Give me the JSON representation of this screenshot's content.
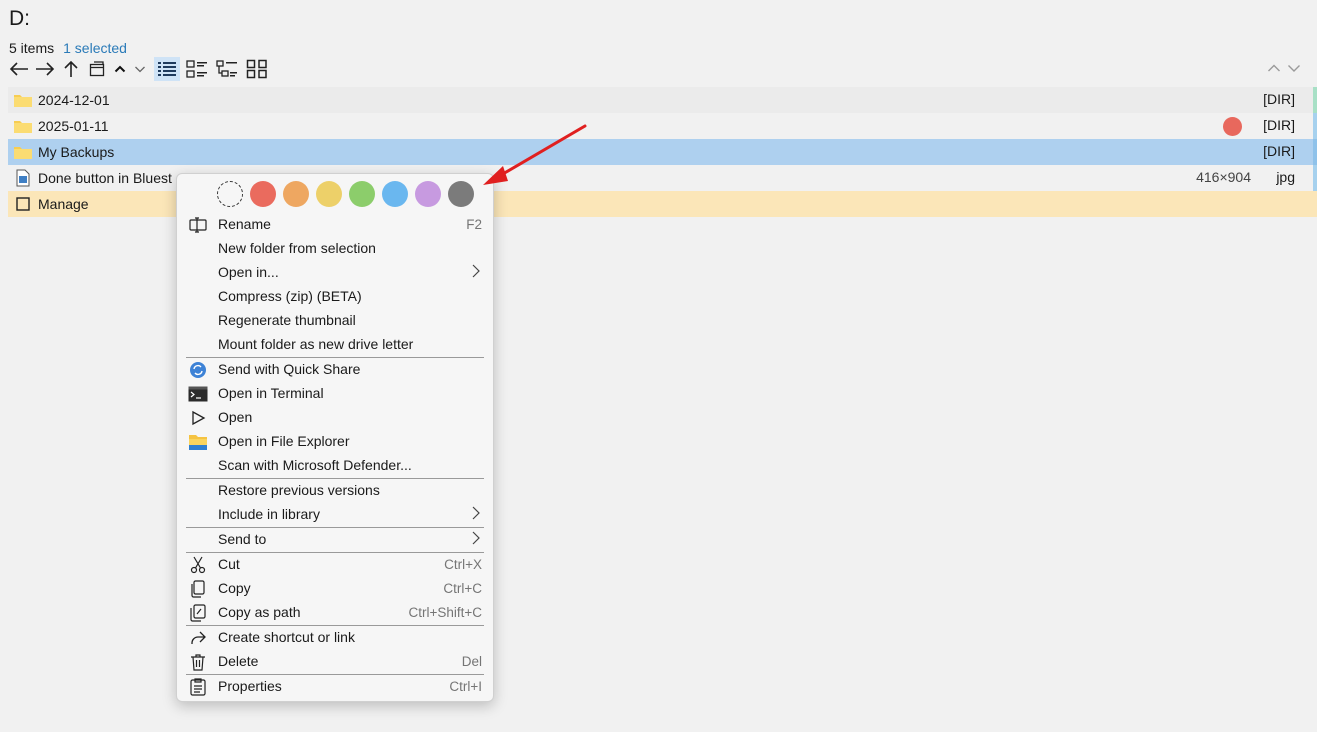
{
  "location": {
    "title": "D:"
  },
  "status": {
    "item_count": "5 items",
    "selection": "1 selected"
  },
  "toolbar": {
    "icons": [
      "back-arrow-icon",
      "forward-arrow-icon",
      "up-arrow-icon",
      "new-tab-icon",
      "chevron-up-icon",
      "chevron-down-icon",
      "details-view-icon",
      "list-view-icon",
      "tree-view-icon",
      "grid-view-icon"
    ],
    "active_view": "details-view"
  },
  "files": [
    {
      "name": "2024-12-01",
      "kind": "folder",
      "type": "[DIR]",
      "edge_color": "#a8e0c6"
    },
    {
      "name": "2025-01-11",
      "kind": "folder",
      "type": "[DIR]",
      "tag_color": "#e8685d",
      "edge_color": "#a6d1ee"
    },
    {
      "name": "My Backups",
      "kind": "folder",
      "type": "[DIR]",
      "selected": true,
      "edge_color": "#a6d1ee"
    },
    {
      "name": "Done button in Bluest",
      "kind": "image",
      "dims": "416×904",
      "type": "jpg",
      "edge_color": "#a6d1ee"
    },
    {
      "name": "Manage",
      "kind": "checkbox"
    }
  ],
  "context_menu": {
    "colors": [
      "none",
      "#ea6b5e",
      "#eea761",
      "#edd069",
      "#8ccd6b",
      "#6ab7ef",
      "#c79ae0",
      "#7b7b7b"
    ],
    "items": {
      "rename": {
        "label": "Rename",
        "shortcut": "F2"
      },
      "new_folder": {
        "label": "New folder from selection"
      },
      "open_in": {
        "label": "Open in..."
      },
      "compress": {
        "label": "Compress (zip) (BETA)"
      },
      "regen_thumb": {
        "label": "Regenerate thumbnail"
      },
      "mount": {
        "label": "Mount folder as new drive letter"
      },
      "quick_share": {
        "label": "Send with Quick Share"
      },
      "terminal": {
        "label": "Open in Terminal"
      },
      "open": {
        "label": "Open"
      },
      "explorer": {
        "label": "Open in File Explorer"
      },
      "defender": {
        "label": "Scan with Microsoft Defender..."
      },
      "restore": {
        "label": "Restore previous versions"
      },
      "library": {
        "label": "Include in library"
      },
      "send_to": {
        "label": "Send to"
      },
      "cut": {
        "label": "Cut",
        "shortcut": "Ctrl+X"
      },
      "copy": {
        "label": "Copy",
        "shortcut": "Ctrl+C"
      },
      "copy_path": {
        "label": "Copy as path",
        "shortcut": "Ctrl+Shift+C"
      },
      "shortcut": {
        "label": "Create shortcut or link"
      },
      "delete": {
        "label": "Delete",
        "shortcut": "Del"
      },
      "properties": {
        "label": "Properties",
        "shortcut": "Ctrl+I"
      }
    }
  },
  "annotation": {
    "arrow_color": "#e02020"
  }
}
